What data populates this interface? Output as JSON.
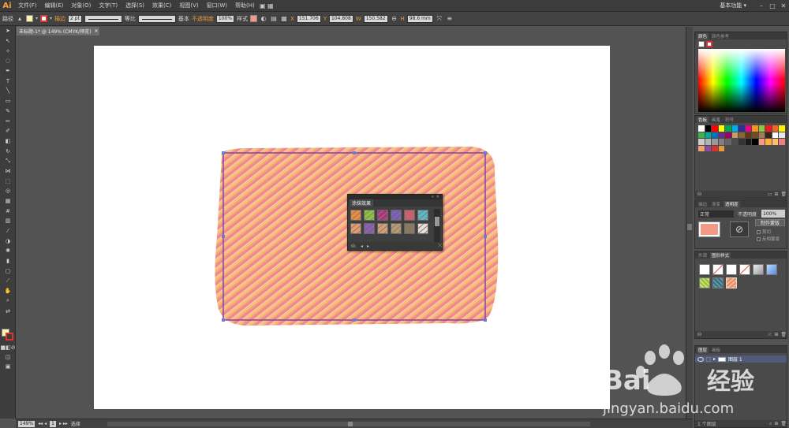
{
  "app": {
    "logo": "Ai"
  },
  "menubar": {
    "items": [
      "文件(F)",
      "编辑(E)",
      "对象(O)",
      "文字(T)",
      "选择(S)",
      "效果(C)",
      "视图(V)",
      "窗口(W)",
      "帮助(H)"
    ],
    "workspace": "基本功能 ▾",
    "window_buttons": [
      "–",
      "□",
      "✕"
    ]
  },
  "controlbar": {
    "selection_label": "路径",
    "stroke_weight_label": "描边",
    "stroke_weight_value": "2 pt",
    "profile_label": "等比",
    "brush_label": "基本",
    "opacity_label": "不透明度",
    "opacity_value": "100%",
    "style_label": "样式",
    "x_value": "151.706",
    "y_value": "104.808",
    "w_value": "150.582",
    "h_value": "98.6 mm"
  },
  "document": {
    "tab_title": "未标题-1* @ 149% (CMYK/预览)",
    "close_icon": "✕"
  },
  "statusbar": {
    "zoom": "149%",
    "artboard_number": "1",
    "tool_status": "选择"
  },
  "panels": {
    "color": {
      "tabs": [
        "颜色",
        "颜色参考"
      ]
    },
    "swatches": {
      "tabs": [
        "色板",
        "画笔",
        "符号"
      ]
    },
    "transparency": {
      "tabs": [
        "描边",
        "渐变",
        "透明度"
      ],
      "blend_mode": "正常",
      "opacity_label": "不透明度",
      "opacity_value": "100%",
      "make_mask_button": "制作蒙版",
      "clip_label": "剪切",
      "invert_label": "反相蒙版"
    },
    "graphic_styles": {
      "tabs": [
        "外观",
        "图形样式"
      ]
    },
    "layers": {
      "tabs": [
        "图层",
        "画板"
      ],
      "layer_name": "图层 1",
      "count_label": "1 个图层"
    }
  },
  "scribble_panel": {
    "tab": "涂抹效果",
    "swatches": [
      {
        "color": "#f08a3a"
      },
      {
        "color": "#8dc23a"
      },
      {
        "color": "#b0307a"
      },
      {
        "color": "#7a5ab8"
      },
      {
        "color": "#d8586a"
      },
      {
        "color": "#5ab8c8"
      },
      {
        "color": "#e89a6a"
      },
      {
        "color": "#8a5ab0"
      },
      {
        "color": "#d8a070"
      },
      {
        "color": "#b89a70"
      },
      {
        "color": "#8a7a5a"
      },
      {
        "color": "#e8e0d8"
      }
    ]
  },
  "colors": {
    "accent": "#e99a38",
    "scribble_pink": "#ef8f8f",
    "scribble_orange": "#f5b050",
    "path_purple": "#8a4aa8"
  },
  "watermark": {
    "brand": "Bai",
    "brand_suffix": "经验",
    "url": "jingyan.baidu.com"
  }
}
